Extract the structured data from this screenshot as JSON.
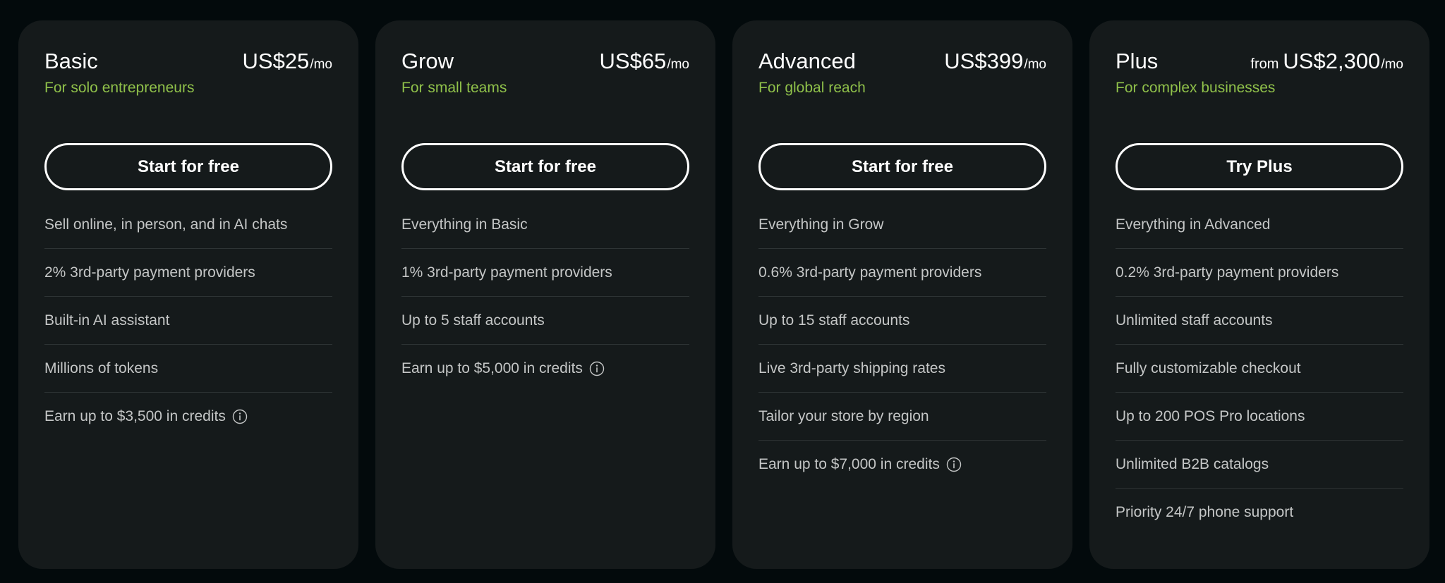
{
  "colors": {
    "page_bg": "#030a0c",
    "card_bg": "#151a1b",
    "accent_green": "#8fc04a",
    "text_primary": "#ffffff",
    "text_secondary": "#c4c6c6",
    "divider": "#2e3435"
  },
  "plans": [
    {
      "name": "Basic",
      "price_prefix": "",
      "price": "US$25",
      "period": "/mo",
      "tagline": "For solo entrepreneurs",
      "cta": "Start for free",
      "features": [
        {
          "text": "Sell online, in person, and in AI chats",
          "info": false
        },
        {
          "text": "2% 3rd-party payment providers",
          "info": false
        },
        {
          "text": "Built-in AI assistant",
          "info": false
        },
        {
          "text": "Millions of tokens",
          "info": false
        },
        {
          "text": "Earn up to $3,500 in credits",
          "info": true
        }
      ]
    },
    {
      "name": "Grow",
      "price_prefix": "",
      "price": "US$65",
      "period": "/mo",
      "tagline": "For small teams",
      "cta": "Start for free",
      "features": [
        {
          "text": "Everything in Basic",
          "info": false
        },
        {
          "text": "1% 3rd-party payment providers",
          "info": false
        },
        {
          "text": "Up to 5 staff accounts",
          "info": false
        },
        {
          "text": "Earn up to $5,000 in credits",
          "info": true
        }
      ]
    },
    {
      "name": "Advanced",
      "price_prefix": "",
      "price": "US$399",
      "period": "/mo",
      "tagline": "For global reach",
      "cta": "Start for free",
      "features": [
        {
          "text": "Everything in Grow",
          "info": false
        },
        {
          "text": "0.6% 3rd-party payment providers",
          "info": false
        },
        {
          "text": "Up to 15 staff accounts",
          "info": false
        },
        {
          "text": "Live 3rd-party shipping rates",
          "info": false
        },
        {
          "text": "Tailor your store by region",
          "info": false
        },
        {
          "text": "Earn up to $7,000 in credits",
          "info": true
        }
      ]
    },
    {
      "name": "Plus",
      "price_prefix": "from",
      "price": "US$2,300",
      "period": "/mo",
      "tagline": "For complex businesses",
      "cta": "Try Plus",
      "features": [
        {
          "text": "Everything in Advanced",
          "info": false
        },
        {
          "text": "0.2% 3rd-party payment providers",
          "info": false
        },
        {
          "text": "Unlimited staff accounts",
          "info": false
        },
        {
          "text": "Fully customizable checkout",
          "info": false
        },
        {
          "text": "Up to 200 POS Pro locations",
          "info": false
        },
        {
          "text": "Unlimited B2B catalogs",
          "info": false
        },
        {
          "text": "Priority 24/7 phone support",
          "info": false
        }
      ]
    }
  ]
}
